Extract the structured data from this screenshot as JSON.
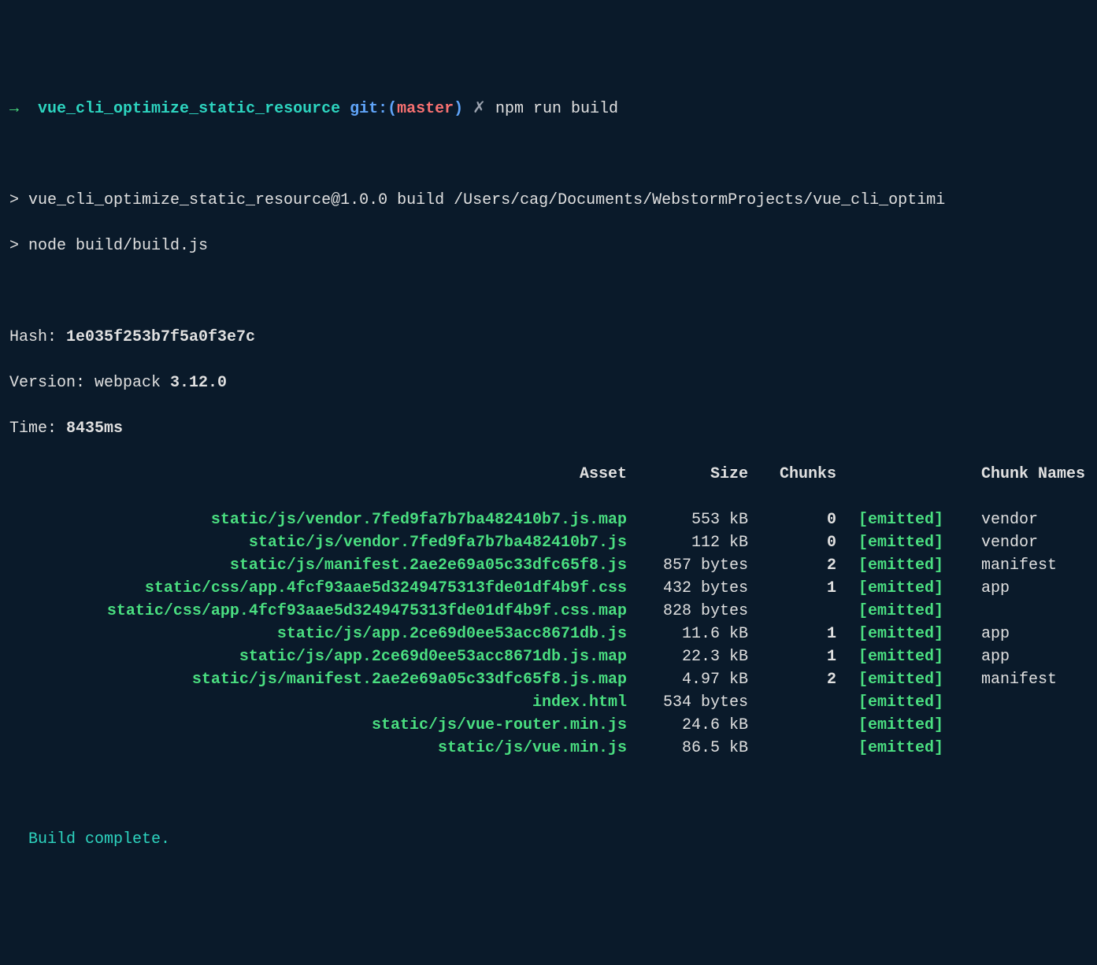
{
  "prompt": {
    "arrow": "→",
    "project": "vue_cli_optimize_static_resource",
    "git_label": "git:(",
    "branch": "master",
    "git_close": ")",
    "dirty": "✗",
    "command": "npm run build"
  },
  "task_lines": [
    "> vue_cli_optimize_static_resource@1.0.0 build /Users/cag/Documents/WebstormProjects/vue_cli_optimi",
    "> node build/build.js"
  ],
  "stats": {
    "hash_label": "Hash: ",
    "hash": "1e035f253b7f5a0f3e7c",
    "version_label": "Version: webpack ",
    "version": "3.12.0",
    "time_label": "Time: ",
    "time": "8435ms"
  },
  "table": {
    "headers": {
      "asset": "Asset",
      "size": "Size",
      "chunks": "Chunks",
      "names": "Chunk Names"
    },
    "rows": [
      {
        "asset": "static/js/vendor.7fed9fa7b7ba482410b7.js.map",
        "size": "553 kB",
        "chunks": "0",
        "emitted": "[emitted]",
        "name": "vendor"
      },
      {
        "asset": "static/js/vendor.7fed9fa7b7ba482410b7.js",
        "size": "112 kB",
        "chunks": "0",
        "emitted": "[emitted]",
        "name": "vendor"
      },
      {
        "asset": "static/js/manifest.2ae2e69a05c33dfc65f8.js",
        "size": "857 bytes",
        "chunks": "2",
        "emitted": "[emitted]",
        "name": "manifest"
      },
      {
        "asset": "static/css/app.4fcf93aae5d3249475313fde01df4b9f.css",
        "size": "432 bytes",
        "chunks": "1",
        "emitted": "[emitted]",
        "name": "app"
      },
      {
        "asset": "static/css/app.4fcf93aae5d3249475313fde01df4b9f.css.map",
        "size": "828 bytes",
        "chunks": "",
        "emitted": "[emitted]",
        "name": ""
      },
      {
        "asset": "static/js/app.2ce69d0ee53acc8671db.js",
        "size": "11.6 kB",
        "chunks": "1",
        "emitted": "[emitted]",
        "name": "app"
      },
      {
        "asset": "static/js/app.2ce69d0ee53acc8671db.js.map",
        "size": "22.3 kB",
        "chunks": "1",
        "emitted": "[emitted]",
        "name": "app"
      },
      {
        "asset": "static/js/manifest.2ae2e69a05c33dfc65f8.js.map",
        "size": "4.97 kB",
        "chunks": "2",
        "emitted": "[emitted]",
        "name": "manifest"
      },
      {
        "asset": "index.html",
        "size": "534 bytes",
        "chunks": "",
        "emitted": "[emitted]",
        "name": ""
      },
      {
        "asset": "static/js/vue-router.min.js",
        "size": "24.6 kB",
        "chunks": "",
        "emitted": "[emitted]",
        "name": ""
      },
      {
        "asset": "static/js/vue.min.js",
        "size": "86.5 kB",
        "chunks": "",
        "emitted": "[emitted]",
        "name": ""
      }
    ]
  },
  "complete": "Build complete."
}
